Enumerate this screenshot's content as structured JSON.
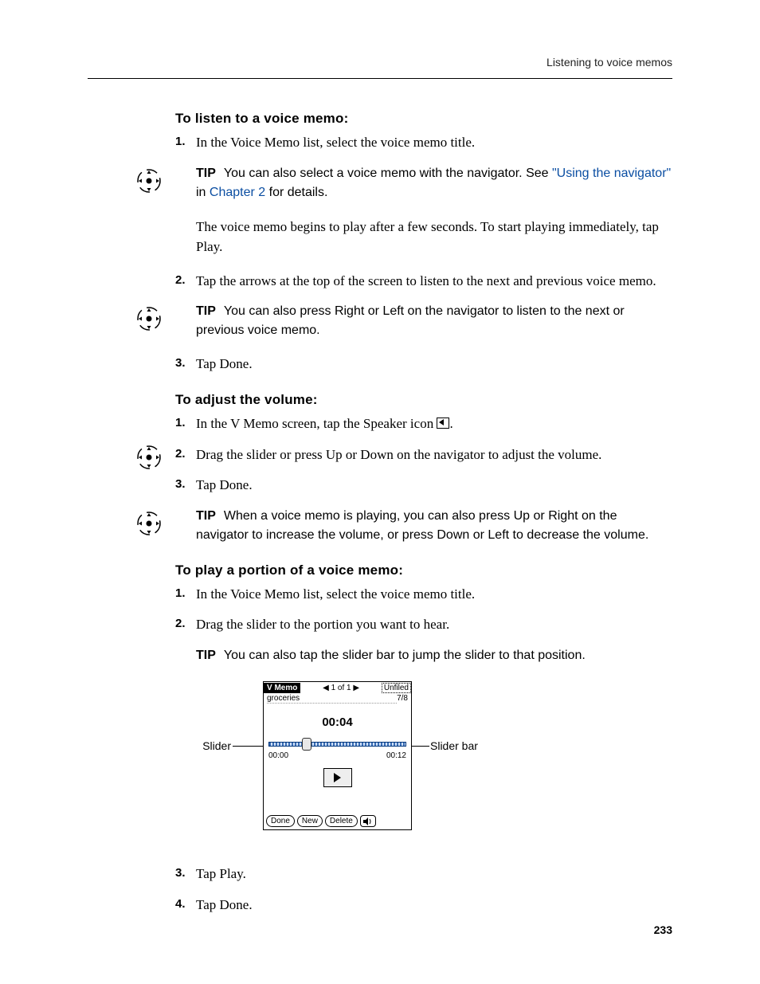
{
  "header": {
    "running_title": "Listening to voice memos"
  },
  "section_listen": {
    "heading": "To listen to a voice memo:",
    "step1": {
      "num": "1.",
      "text": "In the Voice Memo list, select the voice memo title."
    },
    "tip1": {
      "label": "TIP",
      "before_link": "You can also select a voice memo with the navigator. See ",
      "link1": "\"Using the navigator\"",
      "between": " in ",
      "link2": "Chapter 2",
      "after": " for details."
    },
    "para_after_tip1": "The voice memo begins to play after a few seconds. To start playing immediately, tap Play.",
    "step2": {
      "num": "2.",
      "text": "Tap the arrows at the top of the screen to listen to the next and previous voice memo."
    },
    "tip2": {
      "label": "TIP",
      "text": "You can also press Right or Left on the navigator to listen to the next or previous voice memo."
    },
    "step3": {
      "num": "3.",
      "text": "Tap Done."
    }
  },
  "section_volume": {
    "heading": "To adjust the volume:",
    "step1": {
      "num": "1.",
      "text_before_icon": "In the V Memo screen, tap the Speaker icon ",
      "text_after_icon": "."
    },
    "step2": {
      "num": "2.",
      "text": "Drag the slider or press Up or Down on the navigator to adjust the volume."
    },
    "step3": {
      "num": "3.",
      "text": "Tap Done."
    },
    "tip": {
      "label": "TIP",
      "text": "When a voice memo is playing, you can also press Up or Right on the navigator to increase the volume, or press Down or Left to decrease the volume."
    }
  },
  "section_portion": {
    "heading": "To play a portion of a voice memo:",
    "step1": {
      "num": "1.",
      "text": "In the Voice Memo list, select the voice memo title."
    },
    "step2": {
      "num": "2.",
      "text": "Drag the slider to the portion you want to hear."
    },
    "tip": {
      "label": "TIP",
      "text": "You can also tap the slider bar to jump the slider to that position."
    },
    "step3": {
      "num": "3.",
      "text": "Tap Play."
    },
    "step4": {
      "num": "4.",
      "text": "Tap Done."
    }
  },
  "figure": {
    "callout_left": "Slider",
    "callout_right": "Slider bar",
    "app_label": "V Memo",
    "nav_prev": "◀",
    "nav_counter": "1 of 1",
    "nav_next": "▶",
    "category": "Unfiled",
    "memo_name": "groceries",
    "memo_date": "7/8",
    "elapsed": "00:04",
    "time_start": "00:00",
    "time_end": "00:12",
    "btn_done": "Done",
    "btn_new": "New",
    "btn_delete": "Delete"
  },
  "footer": {
    "page_number": "233"
  }
}
